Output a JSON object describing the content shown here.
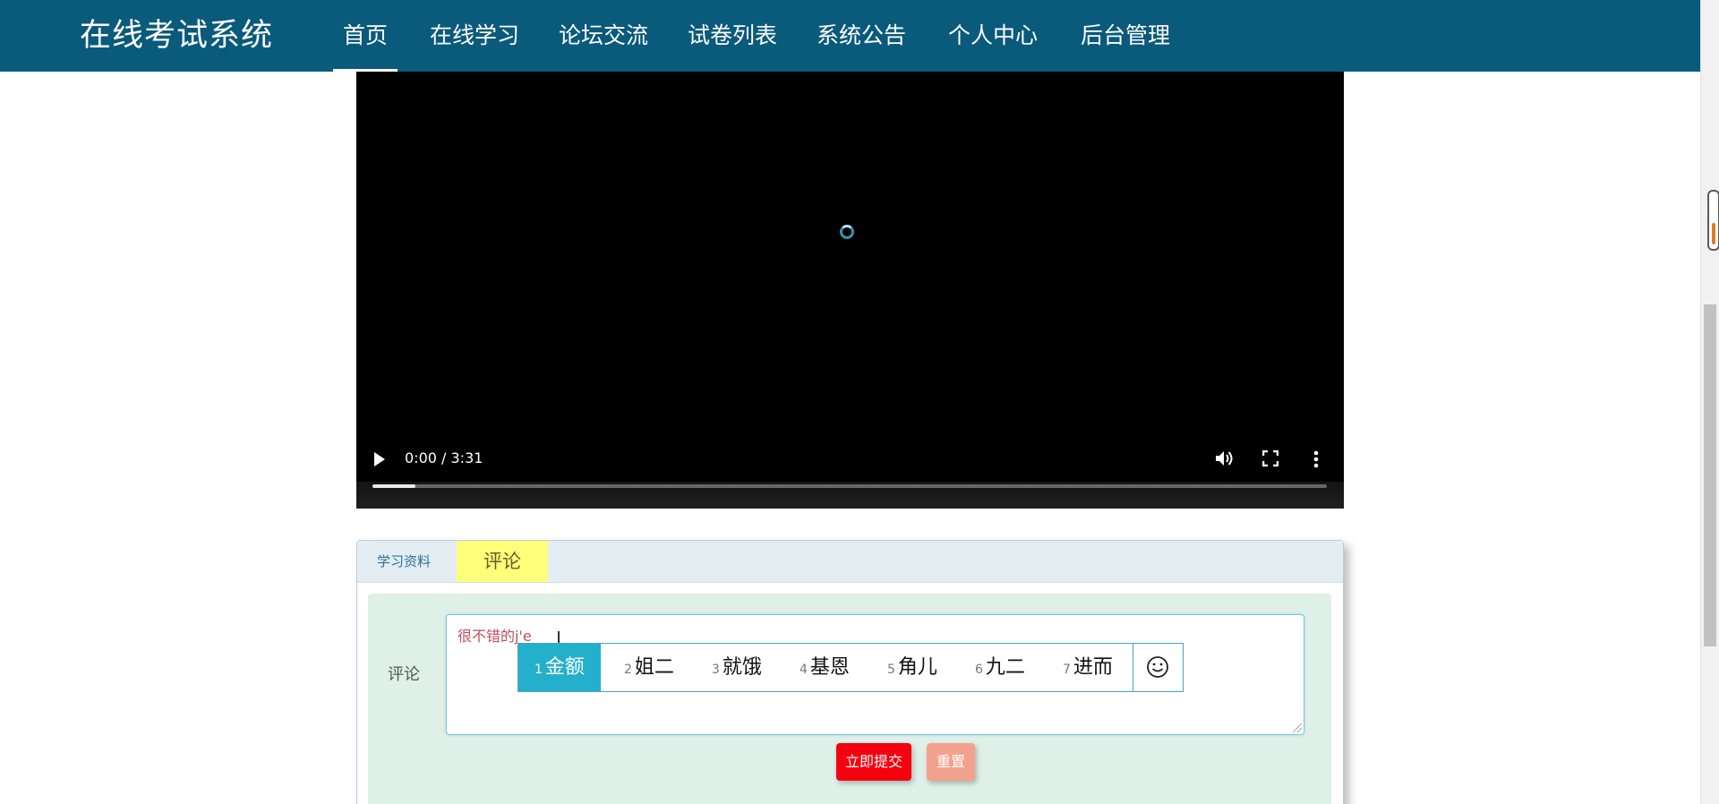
{
  "nav": {
    "brand": "在线考试系统",
    "items": [
      {
        "label": "首页",
        "active": true
      },
      {
        "label": "在线学习"
      },
      {
        "label": "论坛交流"
      },
      {
        "label": "试卷列表"
      },
      {
        "label": "系统公告"
      },
      {
        "label": "个人中心"
      },
      {
        "label": "后台管理"
      }
    ]
  },
  "video": {
    "time": "0:00 / 3:31",
    "buffered_fraction": 0.045,
    "controls": {
      "play_icon": "play-icon",
      "volume_icon": "volume-icon",
      "fullscreen_icon": "fullscreen-icon",
      "more_icon": "more-vert-icon"
    }
  },
  "tabs": {
    "items": [
      {
        "label": "学习资料"
      },
      {
        "label": "评论",
        "active": true
      }
    ]
  },
  "comment_form": {
    "label": "评论",
    "value": "很不错的j'e",
    "submit_label": "立即提交",
    "reset_label": "重置"
  },
  "ime": {
    "candidates": [
      {
        "num": "1",
        "text": "金额",
        "selected": true
      },
      {
        "num": "2",
        "text": "姐二"
      },
      {
        "num": "3",
        "text": "就饿"
      },
      {
        "num": "4",
        "text": "基恩"
      },
      {
        "num": "5",
        "text": "角儿"
      },
      {
        "num": "6",
        "text": "九二"
      },
      {
        "num": "7",
        "text": "进而"
      }
    ],
    "emoji_icon": "smiley-icon"
  },
  "colors": {
    "navbar": "#095a7b",
    "tab_active": "#ffff7a",
    "form_bg": "#dff0e9",
    "submit": "#f5000e",
    "reset": "#f2a28c",
    "ime_selected": "#24b0cc"
  }
}
